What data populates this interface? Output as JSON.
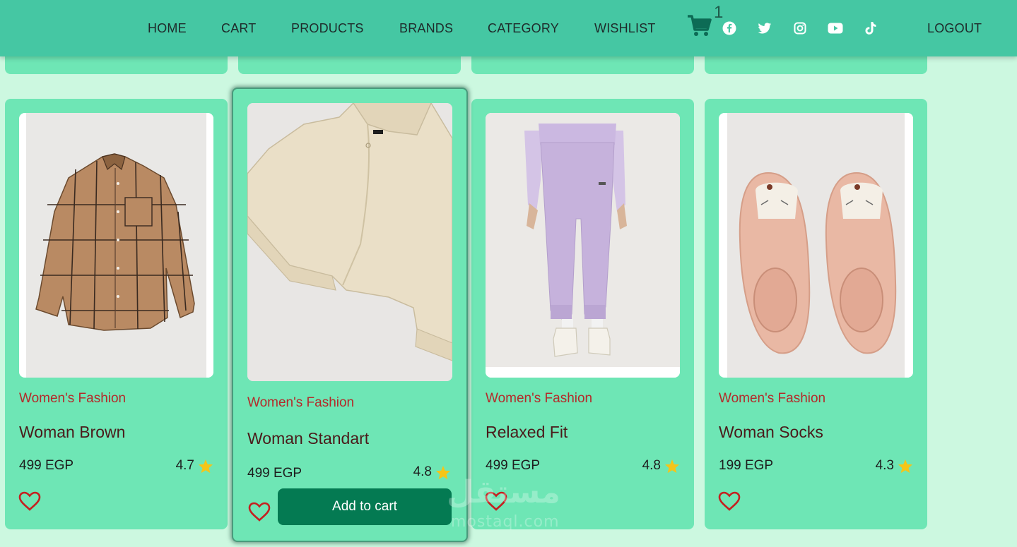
{
  "nav": {
    "links": [
      "HOME",
      "CART",
      "PRODUCTS",
      "BRANDS",
      "CATEGORY",
      "WISHLIST"
    ],
    "cart_count": "1",
    "logout": "LOGOUT",
    "social_icons": [
      "facebook-icon",
      "twitter-icon",
      "instagram-icon",
      "youtube-icon",
      "tiktok-icon"
    ]
  },
  "products": [
    {
      "category": "Women's Fashion",
      "title": "Woman Brown",
      "price": "499 EGP",
      "rating": "4.7"
    },
    {
      "category": "Women's Fashion",
      "title": "Woman Standart",
      "price": "499 EGP",
      "rating": "4.8",
      "button": "Add to cart"
    },
    {
      "category": "Women's Fashion",
      "title": "Relaxed Fit",
      "price": "499 EGP",
      "rating": "4.8"
    },
    {
      "category": "Women's Fashion",
      "title": "Woman Socks",
      "price": "199 EGP",
      "rating": "4.3"
    }
  ],
  "watermark": {
    "arabic": "مستقل",
    "latin": "mostaql.com"
  },
  "colors": {
    "page_bg": "#ccf8e0",
    "navbar": "#45c7a3",
    "card": "#6ee6b5",
    "button": "#047a52",
    "category_text": "#b42a2a",
    "heart": "#c42020",
    "star": "#f5c518"
  }
}
